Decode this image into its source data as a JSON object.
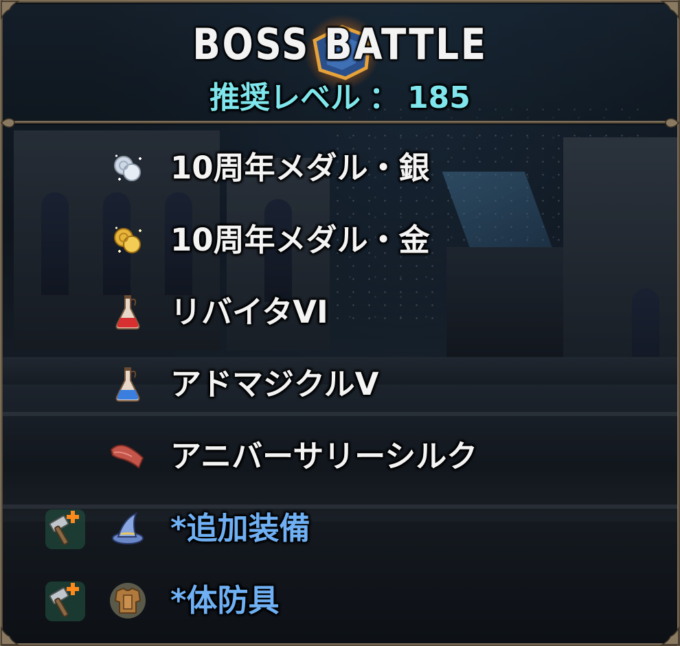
{
  "header": {
    "title": "BOSS BATTLE",
    "level_label": "推奨レベル",
    "level_separator": "：",
    "level_value": "185"
  },
  "rewards": [
    {
      "label": "10周年メダル・銀",
      "icon": "silver-medal-icon",
      "color": "#f4f4f4"
    },
    {
      "label": "10周年メダル・金",
      "icon": "gold-medal-icon",
      "color": "#f4f4f4"
    },
    {
      "label": "リバイタVI",
      "icon": "red-potion-icon",
      "color": "#f4f4f4"
    },
    {
      "label": "アドマジクルV",
      "icon": "blue-potion-icon",
      "color": "#f4f4f4"
    },
    {
      "label": "アニバーサリーシルク",
      "icon": "silk-cloth-icon",
      "color": "#f4f4f4"
    },
    {
      "label": "*追加装備",
      "icon": "wizard-hat-icon",
      "bonus_icon": "hammer-plus-icon",
      "color": "#6fb0f4"
    },
    {
      "label": "*体防具",
      "icon": "body-armor-icon",
      "bonus_icon": "hammer-plus-icon",
      "color": "#6fb0f4"
    }
  ],
  "colors": {
    "title": "#f3f3f3",
    "level": "#7ee6ec",
    "item_text": "#f4f4f4",
    "equipment_text": "#6fb0f4",
    "frame": "#8a7a62"
  }
}
